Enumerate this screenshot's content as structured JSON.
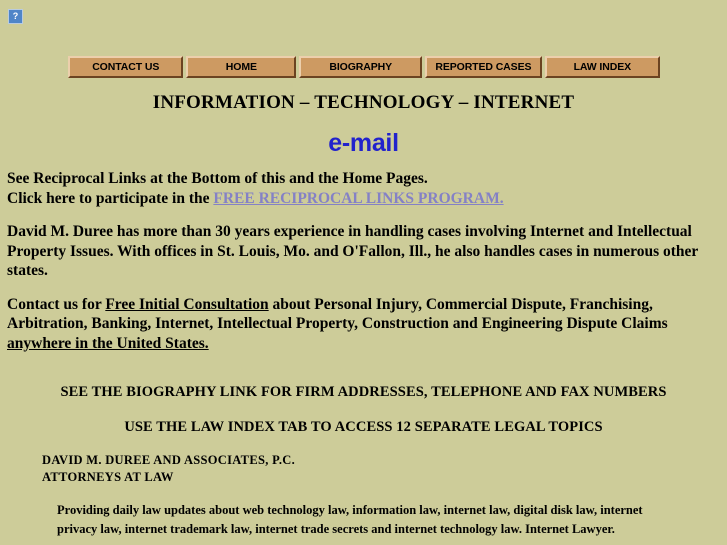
{
  "page": {
    "background_color": "#cdcc99",
    "text_color": "#000000"
  },
  "broken_image": {
    "name": "broken-image-placeholder",
    "glyph": "?"
  },
  "nav": {
    "buttons": [
      {
        "label": "CONTACT US",
        "name": "nav-contact-us"
      },
      {
        "label": "HOME",
        "name": "nav-home"
      },
      {
        "label": "BIOGRAPHY",
        "name": "nav-biography"
      },
      {
        "label": "REPORTED CASES",
        "name": "nav-reported-cases"
      },
      {
        "label": "LAW INDEX",
        "name": "nav-law-index"
      }
    ],
    "button_fill": "#cd9a62",
    "button_highlight": "#eccfac",
    "button_shadow": "#6b4321"
  },
  "headings": {
    "main": "INFORMATION – TECHNOLOGY – INTERNET",
    "email": "e-mail",
    "email_color": "#2222cc"
  },
  "intro": {
    "line1": "See Reciprocal Links at the Bottom of this and the Home Pages.",
    "line2_prefix": "Click here to participate in the ",
    "line2_link": "FREE RECIPROCAL LINKS PROGRAM.",
    "link_color": "#8481c6"
  },
  "paragraph_bio": "David M. Duree has more than 30 years experience in handling cases involving Internet and Intellectual Property Issues.  With offices in St. Louis, Mo. and O'Fallon, Ill., he also handles cases in numerous other states.",
  "paragraph_contact": {
    "prefix": "Contact us for ",
    "link1": "Free Initial Consultation",
    "middle": " about Personal Injury, Commercial Dispute, Franchising, Arbitration, Banking, Internet,  Intellectual Property, Construction and Engineering Dispute Claims ",
    "link2": "anywhere in the United States."
  },
  "caps": {
    "line1": "SEE THE BIOGRAPHY LINK FOR FIRM ADDRESSES, TELEPHONE AND FAX NUMBERS",
    "line2": "USE THE LAW INDEX TAB TO ACCESS 12 SEPARATE LEGAL TOPICS"
  },
  "firm": {
    "name": "DAVID M. DUREE AND ASSOCIATES, P.C.",
    "subtitle": "ATTORNEYS AT LAW"
  },
  "footer": "Providing daily law updates about web technology law, information law, internet law, digital disk law, internet privacy law, internet trademark law, internet trade secrets and internet technology law.  Internet Lawyer."
}
